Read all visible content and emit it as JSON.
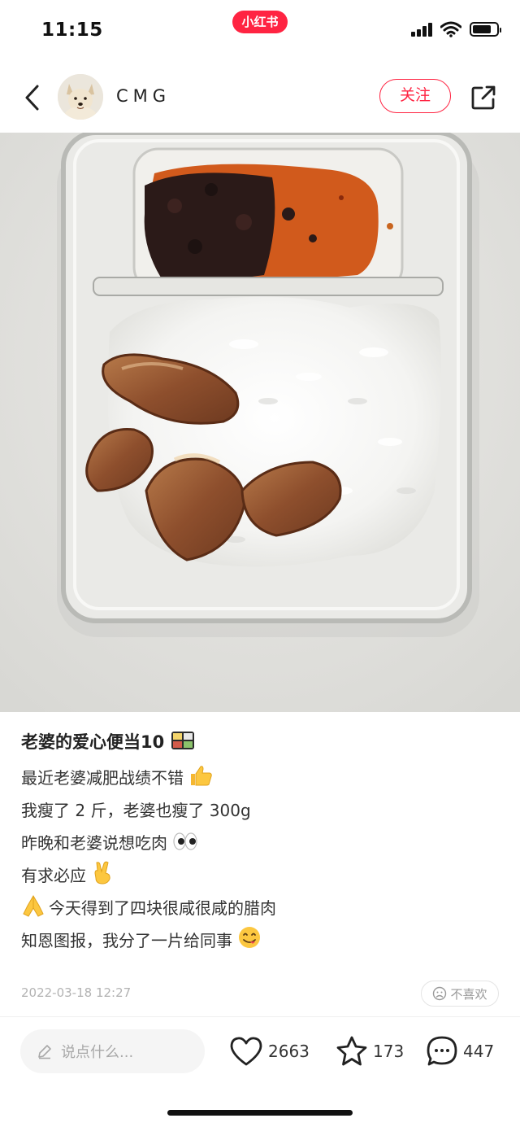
{
  "status_bar": {
    "time": "11:15",
    "app_name": "小红书",
    "battery_level": 0.8
  },
  "nav": {
    "username": "CMG",
    "follow_label": "关注",
    "icons": [
      "back-chevron-icon",
      "avatar-dog-photo",
      "share-icon"
    ]
  },
  "photo": {
    "description_icon": "food-photo",
    "subject": "lunch box with rice, cured meat and chili sauce"
  },
  "post": {
    "title": "老婆的爱心便当10",
    "title_emoji": "bento-icon",
    "lines": [
      {
        "text": "最近老婆减肥战绩不错",
        "emoji_after": "thumbs-up-icon"
      },
      {
        "text": "我瘦了 2 斤，老婆也瘦了 300g"
      },
      {
        "text": "昨晚和老婆说想吃肉",
        "emoji_after": "eyes-icon"
      },
      {
        "text": "有求必应 ",
        "emoji_after": "victory-hand-icon"
      },
      {
        "text": "今天得到了四块很咸很咸的腊肉",
        "emoji_before": "folded-hands-icon"
      },
      {
        "text": "知恩图报，我分了一片给同事",
        "emoji_after": "yum-face-icon"
      }
    ],
    "date": "2022-03-18 12:27",
    "dislike_label": "不喜欢"
  },
  "bottom_bar": {
    "comment_placeholder": "说点什么...",
    "likes": "2663",
    "collects": "173",
    "comments": "447"
  },
  "colors": {
    "brand": "#ff2442",
    "text": "#222222",
    "muted": "#b3b3b3"
  }
}
